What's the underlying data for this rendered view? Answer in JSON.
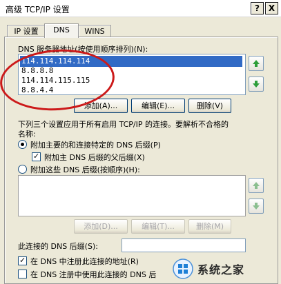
{
  "window": {
    "title": "高级 TCP/IP 设置",
    "help_glyph": "?",
    "close_glyph": "X"
  },
  "tabs": [
    {
      "label": "IP 设置"
    },
    {
      "label": "DNS"
    },
    {
      "label": "WINS"
    }
  ],
  "dns": {
    "servers_label": "DNS 服务器地址(按使用顺序排列)(N):",
    "servers": [
      "114.114.114.114",
      "8.8.8.8",
      "114.114.115.115",
      "8.8.4.4"
    ],
    "add_label": "添加(A)...",
    "edit_label": "编辑(E)...",
    "delete_label": "删除(V)",
    "desc_line1": "下列三个设置应用于所有启用 TCP/IP 的连接。要解析不合格的",
    "desc_line2": "名称:",
    "radio_primary_label": "附加主要的和连接特定的 DNS 后缀(P)",
    "check_parent_label": "附加主 DNS 后缀的父后缀(X)",
    "radio_these_label": "附加这些 DNS 后缀(按顺序)(H):",
    "suffix_add_label": "添加(D)...",
    "suffix_edit_label": "编辑(T)...",
    "suffix_delete_label": "删除(M)",
    "conn_suffix_label": "此连接的 DNS 后缀(S):",
    "register_label": "在 DNS 中注册此连接的地址(R)",
    "use_suffix_label": "在 DNS 注册中使用此连接的 DNS 后"
  },
  "watermark": {
    "text": "系统之家"
  },
  "colors": {
    "dialog_bg": "#ece9d8",
    "selection": "#316ac5",
    "annotation": "#cc1a1a",
    "arrow_green": "#2e9e3a"
  }
}
